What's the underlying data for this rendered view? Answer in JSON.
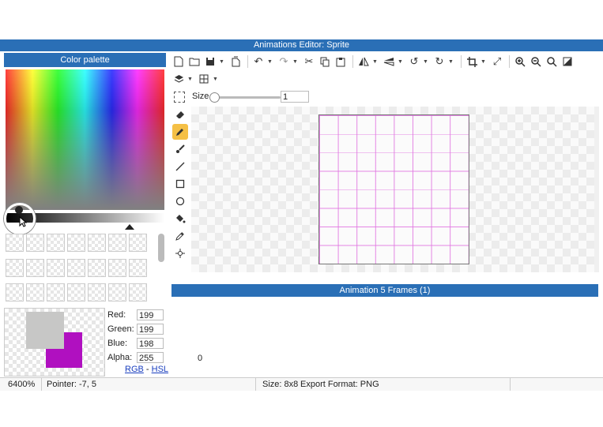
{
  "window": {
    "title": "Animations Editor: Sprite"
  },
  "palette": {
    "header": "Color palette",
    "swatch_count": 21,
    "current_color": "#c7c7c6",
    "secondary_color": "#b010c0",
    "fields": [
      {
        "label": "Red:",
        "value": "199"
      },
      {
        "label": "Green:",
        "value": "199"
      },
      {
        "label": "Blue:",
        "value": "198"
      },
      {
        "label": "Alpha:",
        "value": "255"
      }
    ],
    "mode_rgb": "RGB",
    "mode_sep": " - ",
    "mode_hsl": "HSL"
  },
  "toolbar": {
    "icons": [
      "new-file-icon",
      "open-folder-icon",
      "save-icon",
      "export-icon",
      "undo-icon",
      "redo-icon",
      "cut-icon",
      "copy-icon",
      "paste-icon",
      "flip-horizontal-icon",
      "flip-vertical-icon",
      "rotate-left-icon",
      "rotate-right-icon",
      "crop-icon",
      "resize-icon",
      "zoom-in-icon",
      "zoom-out-icon",
      "zoom-fit-icon",
      "contrast-icon",
      "layers-icon",
      "grid-icon"
    ]
  },
  "size": {
    "label": "Size",
    "value": "1"
  },
  "tools": [
    "eraser-icon",
    "pencil-icon",
    "brush-icon",
    "line-icon",
    "rectangle-icon",
    "ellipse-icon",
    "fill-icon",
    "eyedropper-icon",
    "move-icon"
  ],
  "active_tool": "pencil-icon",
  "animation": {
    "header": "Animation 5 Frames (1)",
    "frame_label": "0"
  },
  "status": {
    "zoom": "6400%",
    "pointer": "Pointer: -7, 5",
    "size": "Size: 8x8",
    "format": "Export Format: PNG"
  },
  "colors": {
    "accent": "#2a6fb6",
    "grid_line": "#e178e1",
    "active_tool_bg": "#f5c046"
  }
}
